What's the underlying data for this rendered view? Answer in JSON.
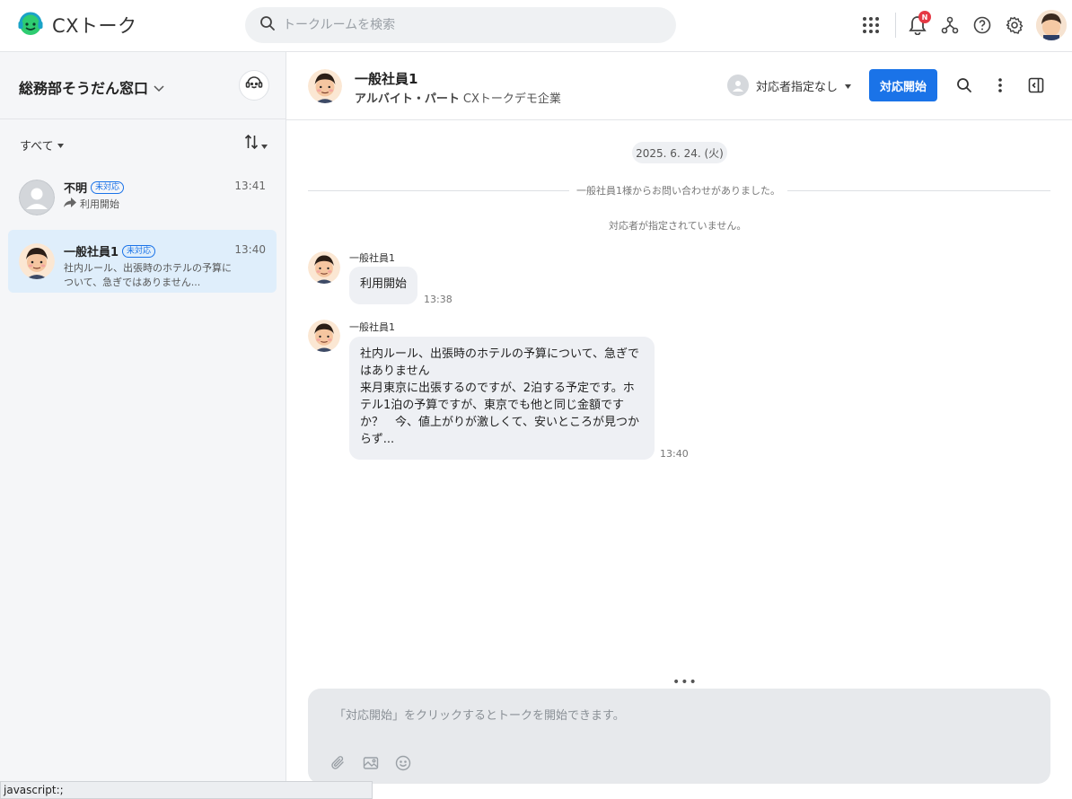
{
  "app": {
    "name": "CXトーク"
  },
  "search": {
    "placeholder": "トークルームを検索"
  },
  "notifications": {
    "badge": "N"
  },
  "sidebar": {
    "title": "総務部そうだん窓口",
    "filter_label": "すべて",
    "conversations": [
      {
        "name": "不明",
        "tag": "未対応",
        "time": "13:41",
        "preview": "利用開始",
        "active": false
      },
      {
        "name": "一般社員1",
        "tag": "未対応",
        "time": "13:40",
        "preview": "社内ルール、出張時のホテルの予算について、急ぎではありません...",
        "active": true
      }
    ]
  },
  "chat": {
    "name": "一般社員1",
    "role": "アルバイト・パート",
    "company": "CXトークデモ企業",
    "assignee_label": "対応者指定なし",
    "start_button": "対応開始",
    "date": "2025. 6. 24. (火)",
    "system_messages": [
      "一般社員1様からお問い合わせがありました。",
      "対応者が指定されていません。"
    ],
    "messages": [
      {
        "sender": "一般社員1",
        "text": "利用開始",
        "time": "13:38"
      },
      {
        "sender": "一般社員1",
        "text_lines": [
          "社内ルール、出張時のホテルの予算について、急ぎで",
          "はありません",
          "来月東京に出張するのですが、2泊する予定です。ホ",
          "テル1泊の予算ですが、東京でも他と同じ金額です",
          "か？　今、値上がりが激しくて、安いところが見つか",
          "らず..."
        ],
        "time": "13:40"
      }
    ],
    "composer_placeholder": "「対応開始」をクリックするとトークを開始できます。"
  },
  "statusbar": {
    "text": "javascript:;"
  },
  "colors": {
    "accent": "#1a73e8",
    "selected_row": "#dfeefb",
    "badge": "#e53945"
  }
}
